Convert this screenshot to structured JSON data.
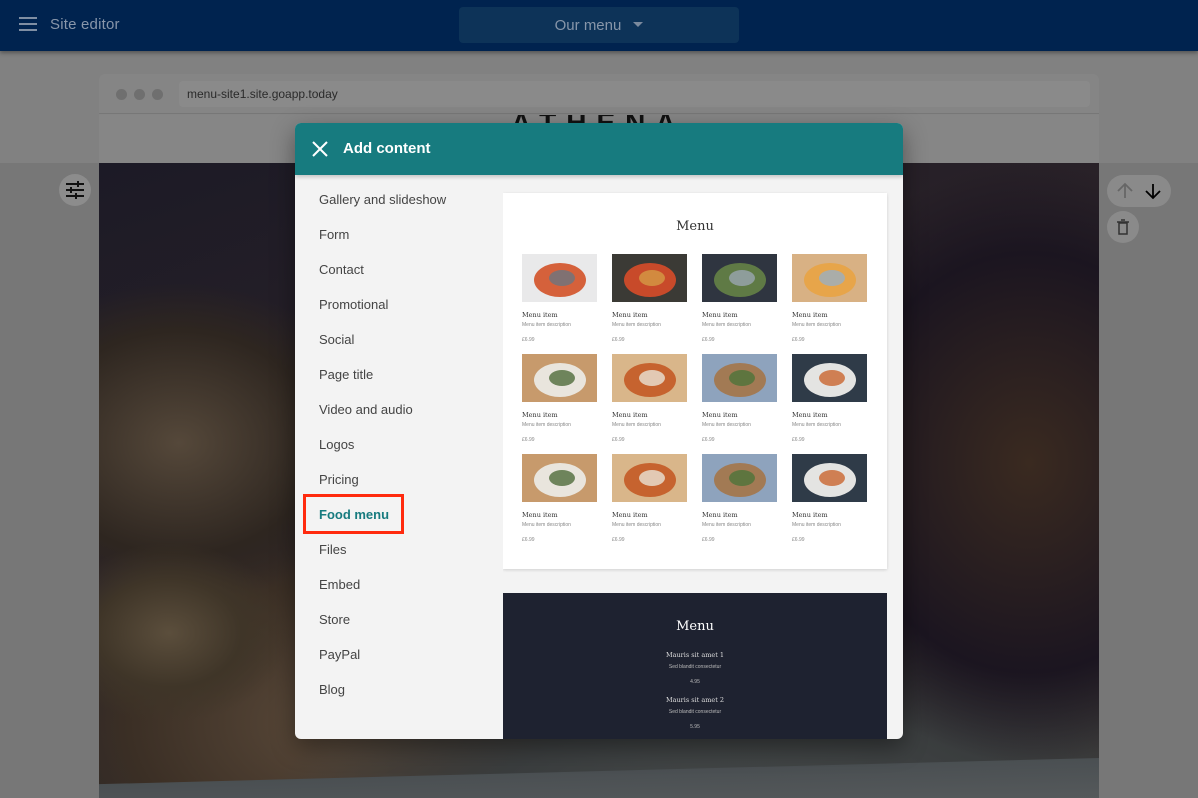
{
  "appbar": {
    "title": "Site editor",
    "page_selector": "Our menu",
    "icons": {
      "menu": "hamburger-icon",
      "dropdown": "caret-down-icon"
    }
  },
  "browser": {
    "url": "menu-site1.site.goapp.today",
    "site_logo": "ATHENA"
  },
  "section_controls": {
    "settings_icon": "tune-sliders-icon",
    "move_up_icon": "arrow-up-icon",
    "move_down_icon": "arrow-down-icon",
    "delete_icon": "trash-icon"
  },
  "dialog": {
    "title": "Add content",
    "close_icon": "close-icon",
    "categories": [
      {
        "label": "Gallery and slideshow",
        "active": false
      },
      {
        "label": "Form",
        "active": false
      },
      {
        "label": "Contact",
        "active": false
      },
      {
        "label": "Promotional",
        "active": false
      },
      {
        "label": "Social",
        "active": false
      },
      {
        "label": "Page title",
        "active": false
      },
      {
        "label": "Video and audio",
        "active": false
      },
      {
        "label": "Logos",
        "active": false
      },
      {
        "label": "Pricing",
        "active": false
      },
      {
        "label": "Food menu",
        "active": true
      },
      {
        "label": "Files",
        "active": false
      },
      {
        "label": "Embed",
        "active": false
      },
      {
        "label": "Store",
        "active": false
      },
      {
        "label": "PayPal",
        "active": false
      },
      {
        "label": "Blog",
        "active": false
      }
    ],
    "accent_color": "#177b7f",
    "highlight_color": "#ff2a0e",
    "templates": {
      "grid_menu": {
        "title": "Menu",
        "items": [
          {
            "name": "Menu item",
            "description": "Menu item description",
            "price": "£6.99",
            "image": "tomato-soup"
          },
          {
            "name": "Menu item",
            "description": "Menu item description",
            "price": "£6.99",
            "image": "bruschetta"
          },
          {
            "name": "Menu item",
            "description": "Menu item description",
            "price": "£6.99",
            "image": "salad-dark-plate"
          },
          {
            "name": "Menu item",
            "description": "Menu item description",
            "price": "£6.99",
            "image": "pasta"
          },
          {
            "name": "Menu item",
            "description": "Menu item description",
            "price": "£6.99",
            "image": "pizza-white"
          },
          {
            "name": "Menu item",
            "description": "Menu item description",
            "price": "£6.99",
            "image": "pizza-fork"
          },
          {
            "name": "Menu item",
            "description": "Menu item description",
            "price": "£6.99",
            "image": "pizza-rocket"
          },
          {
            "name": "Menu item",
            "description": "Menu item description",
            "price": "£6.99",
            "image": "pizza-plate"
          },
          {
            "name": "Menu item",
            "description": "Menu item description",
            "price": "£6.99",
            "image": "pizza-white"
          },
          {
            "name": "Menu item",
            "description": "Menu item description",
            "price": "£6.99",
            "image": "pizza-fork"
          },
          {
            "name": "Menu item",
            "description": "Menu item description",
            "price": "£6.99",
            "image": "pizza-rocket"
          },
          {
            "name": "Menu item",
            "description": "Menu item description",
            "price": "£6.99",
            "image": "pizza-plate"
          }
        ]
      },
      "list_menu_dark": {
        "title": "Menu",
        "items": [
          {
            "name": "Mauris sit amet 1",
            "description": "Sed blandit consectetur",
            "price": "4.95"
          },
          {
            "name": "Mauris sit amet 2",
            "description": "Sed blandit consectetur",
            "price": "5.95"
          }
        ]
      }
    }
  }
}
